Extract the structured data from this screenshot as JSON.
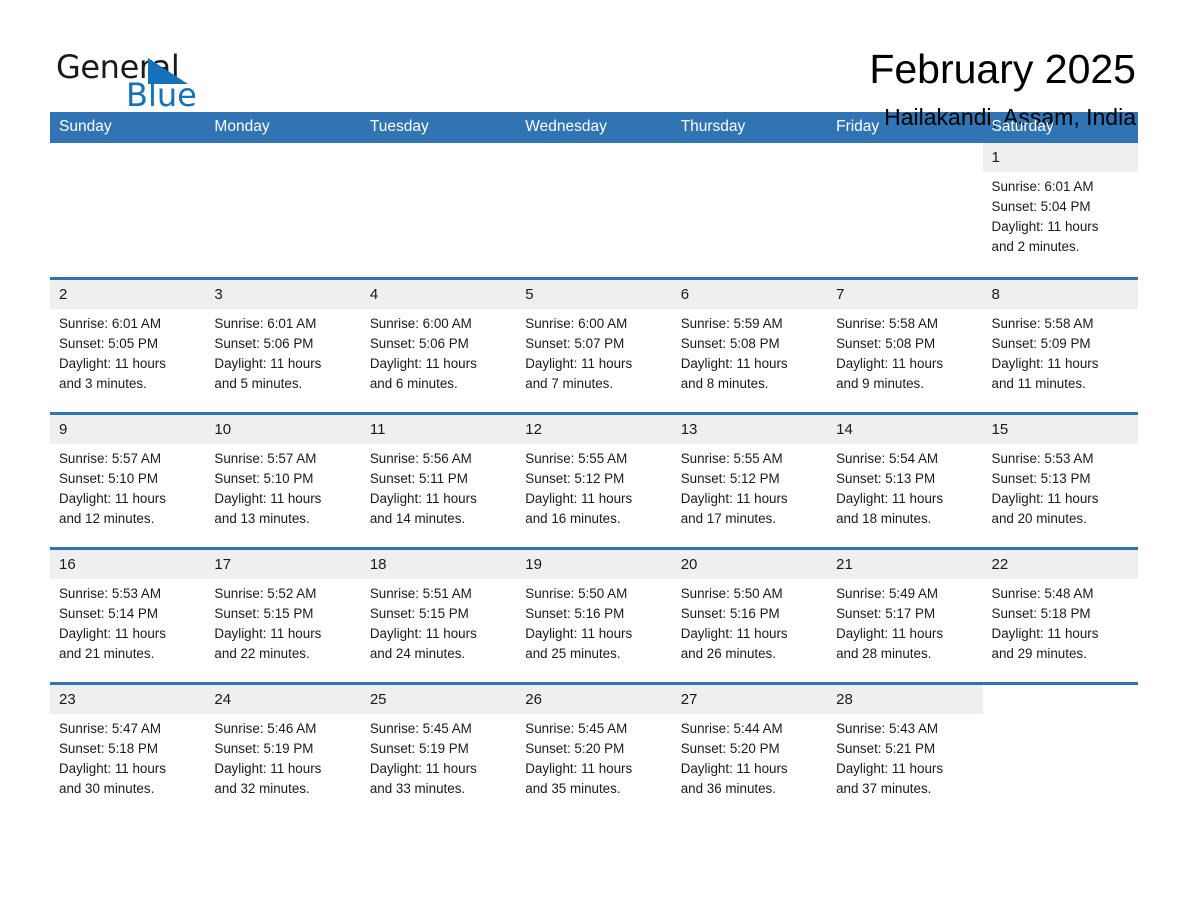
{
  "logo": {
    "word1": "General",
    "word2": "Blue",
    "icon": "triangle-flag-icon",
    "brand_black": "#1a1a1a",
    "brand_blue": "#1372b8"
  },
  "header": {
    "title": "February 2025",
    "location": "Hailakandi, Assam, India"
  },
  "colors": {
    "header_blue": "#3174b4",
    "daynum_band": "#efefef",
    "text": "#1a1a1a"
  },
  "weekdays": [
    "Sunday",
    "Monday",
    "Tuesday",
    "Wednesday",
    "Thursday",
    "Friday",
    "Saturday"
  ],
  "weeks": [
    [
      {
        "day": "",
        "empty": true
      },
      {
        "day": "",
        "empty": true
      },
      {
        "day": "",
        "empty": true
      },
      {
        "day": "",
        "empty": true
      },
      {
        "day": "",
        "empty": true
      },
      {
        "day": "",
        "empty": true
      },
      {
        "day": "1",
        "sunrise": "Sunrise: 6:01 AM",
        "sunset": "Sunset: 5:04 PM",
        "daylight1": "Daylight: 11 hours",
        "daylight2": "and 2 minutes."
      }
    ],
    [
      {
        "day": "2",
        "sunrise": "Sunrise: 6:01 AM",
        "sunset": "Sunset: 5:05 PM",
        "daylight1": "Daylight: 11 hours",
        "daylight2": "and 3 minutes."
      },
      {
        "day": "3",
        "sunrise": "Sunrise: 6:01 AM",
        "sunset": "Sunset: 5:06 PM",
        "daylight1": "Daylight: 11 hours",
        "daylight2": "and 5 minutes."
      },
      {
        "day": "4",
        "sunrise": "Sunrise: 6:00 AM",
        "sunset": "Sunset: 5:06 PM",
        "daylight1": "Daylight: 11 hours",
        "daylight2": "and 6 minutes."
      },
      {
        "day": "5",
        "sunrise": "Sunrise: 6:00 AM",
        "sunset": "Sunset: 5:07 PM",
        "daylight1": "Daylight: 11 hours",
        "daylight2": "and 7 minutes."
      },
      {
        "day": "6",
        "sunrise": "Sunrise: 5:59 AM",
        "sunset": "Sunset: 5:08 PM",
        "daylight1": "Daylight: 11 hours",
        "daylight2": "and 8 minutes."
      },
      {
        "day": "7",
        "sunrise": "Sunrise: 5:58 AM",
        "sunset": "Sunset: 5:08 PM",
        "daylight1": "Daylight: 11 hours",
        "daylight2": "and 9 minutes."
      },
      {
        "day": "8",
        "sunrise": "Sunrise: 5:58 AM",
        "sunset": "Sunset: 5:09 PM",
        "daylight1": "Daylight: 11 hours",
        "daylight2": "and 11 minutes."
      }
    ],
    [
      {
        "day": "9",
        "sunrise": "Sunrise: 5:57 AM",
        "sunset": "Sunset: 5:10 PM",
        "daylight1": "Daylight: 11 hours",
        "daylight2": "and 12 minutes."
      },
      {
        "day": "10",
        "sunrise": "Sunrise: 5:57 AM",
        "sunset": "Sunset: 5:10 PM",
        "daylight1": "Daylight: 11 hours",
        "daylight2": "and 13 minutes."
      },
      {
        "day": "11",
        "sunrise": "Sunrise: 5:56 AM",
        "sunset": "Sunset: 5:11 PM",
        "daylight1": "Daylight: 11 hours",
        "daylight2": "and 14 minutes."
      },
      {
        "day": "12",
        "sunrise": "Sunrise: 5:55 AM",
        "sunset": "Sunset: 5:12 PM",
        "daylight1": "Daylight: 11 hours",
        "daylight2": "and 16 minutes."
      },
      {
        "day": "13",
        "sunrise": "Sunrise: 5:55 AM",
        "sunset": "Sunset: 5:12 PM",
        "daylight1": "Daylight: 11 hours",
        "daylight2": "and 17 minutes."
      },
      {
        "day": "14",
        "sunrise": "Sunrise: 5:54 AM",
        "sunset": "Sunset: 5:13 PM",
        "daylight1": "Daylight: 11 hours",
        "daylight2": "and 18 minutes."
      },
      {
        "day": "15",
        "sunrise": "Sunrise: 5:53 AM",
        "sunset": "Sunset: 5:13 PM",
        "daylight1": "Daylight: 11 hours",
        "daylight2": "and 20 minutes."
      }
    ],
    [
      {
        "day": "16",
        "sunrise": "Sunrise: 5:53 AM",
        "sunset": "Sunset: 5:14 PM",
        "daylight1": "Daylight: 11 hours",
        "daylight2": "and 21 minutes."
      },
      {
        "day": "17",
        "sunrise": "Sunrise: 5:52 AM",
        "sunset": "Sunset: 5:15 PM",
        "daylight1": "Daylight: 11 hours",
        "daylight2": "and 22 minutes."
      },
      {
        "day": "18",
        "sunrise": "Sunrise: 5:51 AM",
        "sunset": "Sunset: 5:15 PM",
        "daylight1": "Daylight: 11 hours",
        "daylight2": "and 24 minutes."
      },
      {
        "day": "19",
        "sunrise": "Sunrise: 5:50 AM",
        "sunset": "Sunset: 5:16 PM",
        "daylight1": "Daylight: 11 hours",
        "daylight2": "and 25 minutes."
      },
      {
        "day": "20",
        "sunrise": "Sunrise: 5:50 AM",
        "sunset": "Sunset: 5:16 PM",
        "daylight1": "Daylight: 11 hours",
        "daylight2": "and 26 minutes."
      },
      {
        "day": "21",
        "sunrise": "Sunrise: 5:49 AM",
        "sunset": "Sunset: 5:17 PM",
        "daylight1": "Daylight: 11 hours",
        "daylight2": "and 28 minutes."
      },
      {
        "day": "22",
        "sunrise": "Sunrise: 5:48 AM",
        "sunset": "Sunset: 5:18 PM",
        "daylight1": "Daylight: 11 hours",
        "daylight2": "and 29 minutes."
      }
    ],
    [
      {
        "day": "23",
        "sunrise": "Sunrise: 5:47 AM",
        "sunset": "Sunset: 5:18 PM",
        "daylight1": "Daylight: 11 hours",
        "daylight2": "and 30 minutes."
      },
      {
        "day": "24",
        "sunrise": "Sunrise: 5:46 AM",
        "sunset": "Sunset: 5:19 PM",
        "daylight1": "Daylight: 11 hours",
        "daylight2": "and 32 minutes."
      },
      {
        "day": "25",
        "sunrise": "Sunrise: 5:45 AM",
        "sunset": "Sunset: 5:19 PM",
        "daylight1": "Daylight: 11 hours",
        "daylight2": "and 33 minutes."
      },
      {
        "day": "26",
        "sunrise": "Sunrise: 5:45 AM",
        "sunset": "Sunset: 5:20 PM",
        "daylight1": "Daylight: 11 hours",
        "daylight2": "and 35 minutes."
      },
      {
        "day": "27",
        "sunrise": "Sunrise: 5:44 AM",
        "sunset": "Sunset: 5:20 PM",
        "daylight1": "Daylight: 11 hours",
        "daylight2": "and 36 minutes."
      },
      {
        "day": "28",
        "sunrise": "Sunrise: 5:43 AM",
        "sunset": "Sunset: 5:21 PM",
        "daylight1": "Daylight: 11 hours",
        "daylight2": "and 37 minutes."
      },
      {
        "day": "",
        "empty": true
      }
    ]
  ]
}
